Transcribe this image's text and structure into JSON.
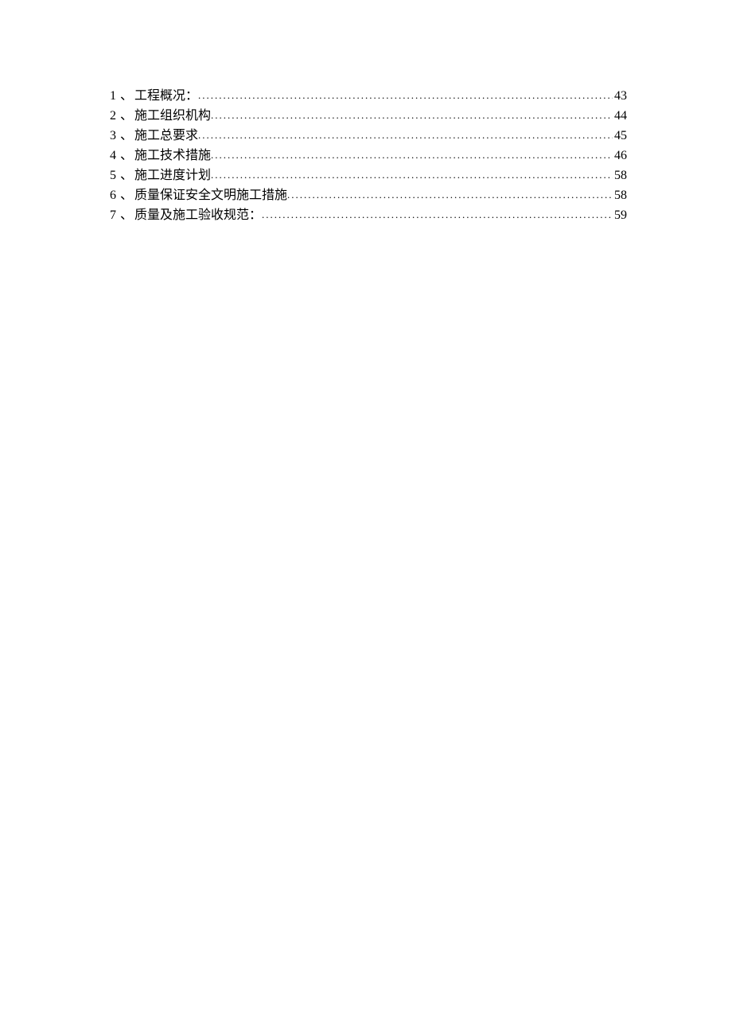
{
  "toc": {
    "entries": [
      {
        "number": "1",
        "separator": "、",
        "title": "工程概况：",
        "page": "43"
      },
      {
        "number": "2",
        "separator": "、",
        "title": "施工组织机构",
        "page": "44"
      },
      {
        "number": "3",
        "separator": "、",
        "title": "施工总要求",
        "page": "45"
      },
      {
        "number": "4",
        "separator": "、",
        "title": "施工技术措施",
        "page": "46"
      },
      {
        "number": "5",
        "separator": "、",
        "title": "施工进度计划",
        "page": "58"
      },
      {
        "number": "6",
        "separator": "、",
        "title": "质量保证安全文明施工措施",
        "page": "58"
      },
      {
        "number": "7",
        "separator": "、",
        "title": "质量及施工验收规范：",
        "page": "59"
      }
    ]
  }
}
